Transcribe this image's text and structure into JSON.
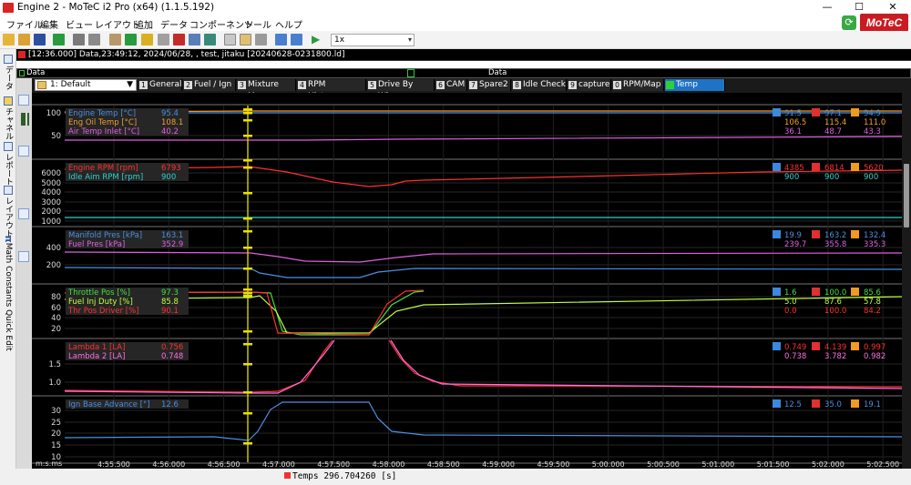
{
  "window": {
    "title": "Engine 2 - MoTeC i2 Pro (x64) (1.1.5.192)",
    "minimize": "—",
    "maximize": "☐",
    "close": "✕"
  },
  "menu": [
    "ファイル",
    "編集",
    "ビュー",
    "レイアウト",
    "追加",
    "データ",
    "コンポーネント",
    "ツール",
    "ヘルプ"
  ],
  "brand": {
    "logo": "MoTeC",
    "accent": "#c91c22"
  },
  "toolbar": {
    "zoom_value": "1x"
  },
  "infobar": {
    "text": "[12:36.000] Data,23:49:12, 2024/06/28, , test, jitaku [20240628-0231800.ld]"
  },
  "side_tabs": [
    "データ",
    "チャネル",
    "レポート",
    "レイアウト",
    "Math Constants Quick Edit"
  ],
  "databar": {
    "left": "Data",
    "center": "Data"
  },
  "worksheet_select": "1: Default",
  "tabs": [
    {
      "num": "1",
      "label": "General"
    },
    {
      "num": "2",
      "label": "Fuel / Ign"
    },
    {
      "num": "3",
      "label": "Mixture Map"
    },
    {
      "num": "4",
      "label": "RPM Histogram"
    },
    {
      "num": "5",
      "label": "Drive By Wire"
    },
    {
      "num": "6",
      "label": "CAM"
    },
    {
      "num": "7",
      "label": "Spare2"
    },
    {
      "num": "8",
      "label": "Idle Check"
    },
    {
      "num": "9",
      "label": "capture"
    },
    {
      "num": "0",
      "label": "RPM/Map"
    },
    {
      "num": "",
      "label": "Temp"
    }
  ],
  "graphs": [
    {
      "yticks": [
        "100",
        "50"
      ],
      "channels": [
        {
          "name": "Engine Temp [°C]",
          "cursor": "95.4",
          "min": "91.5",
          "max": "97.1",
          "avg": "94.9",
          "color": "#4a90e2"
        },
        {
          "name": "Eng Oil Temp [°C]",
          "cursor": "108.1",
          "min": "106.5",
          "max": "115.4",
          "avg": "111.0",
          "color": "#f0a030"
        },
        {
          "name": "Air Temp Inlet [°C]",
          "cursor": "40.2",
          "min": "36.1",
          "max": "48.7",
          "avg": "43.3",
          "color": "#e060e0"
        }
      ]
    },
    {
      "yticks": [
        "6000",
        "5000",
        "4000",
        "3000",
        "2000",
        "1000"
      ],
      "channels": [
        {
          "name": "Engine RPM [rpm]",
          "cursor": "6793",
          "min": "4385",
          "max": "6814",
          "avg": "5620",
          "color": "#ff3030"
        },
        {
          "name": "Idle Aim RPM [rpm]",
          "cursor": "900",
          "min": "900",
          "max": "900",
          "avg": "900",
          "color": "#30d0d0"
        }
      ]
    },
    {
      "yticks": [
        "400",
        "200"
      ],
      "channels": [
        {
          "name": "Manifold Pres [kPa]",
          "cursor": "163.1",
          "min": "19.9",
          "max": "163.2",
          "avg": "132.4",
          "color": "#4a90e2"
        },
        {
          "name": "Fuel Pres [kPa]",
          "cursor": "352.9",
          "min": "239.7",
          "max": "355.8",
          "avg": "335.3",
          "color": "#e060e0"
        }
      ]
    },
    {
      "yticks": [
        "80",
        "60",
        "40",
        "20"
      ],
      "channels": [
        {
          "name": "Throttle Pos [%]",
          "cursor": "97.3",
          "min": "1.6",
          "max": "100.0",
          "avg": "85.6",
          "color": "#40e040"
        },
        {
          "name": "Fuel Inj Duty [%]",
          "cursor": "85.8",
          "min": "5.0",
          "max": "87.6",
          "avg": "57.8",
          "color": "#c0ff40"
        },
        {
          "name": "Thr Pos Driver [%]",
          "cursor": "90.1",
          "min": "0.0",
          "max": "100.0",
          "avg": "84.2",
          "color": "#ff3030"
        }
      ]
    },
    {
      "yticks": [
        "1.5",
        "1.0"
      ],
      "channels": [
        {
          "name": "Lambda 1 [LA]",
          "cursor": "0.756",
          "min": "0.749",
          "max": "4.139",
          "avg": "0.997",
          "color": "#ff3030"
        },
        {
          "name": "Lambda 2 [LA]",
          "cursor": "0.748",
          "min": "0.738",
          "max": "3.782",
          "avg": "0.982",
          "color": "#ff70e0"
        }
      ]
    },
    {
      "yticks": [
        "30",
        "25",
        "20",
        "15",
        "10"
      ],
      "channels": [
        {
          "name": "Ign Base Advance [°]",
          "cursor": "12.6",
          "min": "12.5",
          "max": "35.0",
          "avg": "19.1",
          "color": "#4a90e2"
        }
      ]
    }
  ],
  "xaxis": {
    "unit": "m:s.ms",
    "ticks": [
      "4:55.500",
      "4:56.000",
      "4:56.500",
      "4:57.000",
      "4:57.500",
      "4:58.000",
      "4:58.500",
      "4:59.000",
      "4:59.500",
      "5:00.000",
      "5:00.500",
      "5:01.000",
      "5:01.500",
      "5:02.000",
      "5:02.500"
    ]
  },
  "status": {
    "time_label": "Temps 296.704260 [s]"
  },
  "colors": {
    "cursor": "#e8e000",
    "grid": "#333333",
    "background": "#000000"
  }
}
